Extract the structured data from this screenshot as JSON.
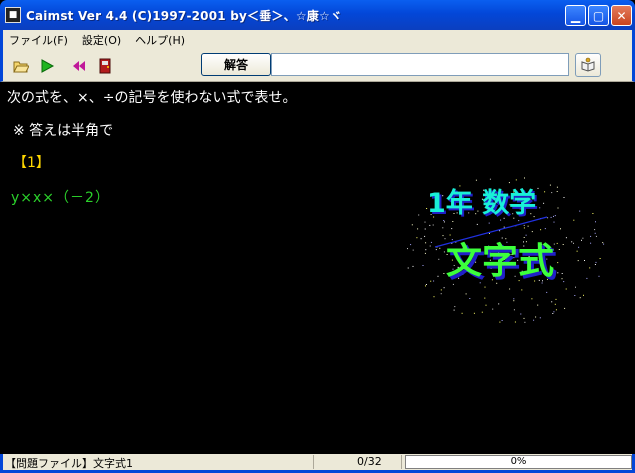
{
  "window": {
    "title": "Caimst Ver 4.4 (C)1997-2001  by＜垂＞、☆康☆ヾ",
    "icon": "app-icon"
  },
  "menu": {
    "items": [
      {
        "label": "ファイル(F)"
      },
      {
        "label": "設定(O)"
      },
      {
        "label": "ヘルプ(H)"
      }
    ]
  },
  "toolbar": {
    "icons": [
      "open-folder-icon",
      "play-icon",
      "rewind-icon",
      "exit-door-icon"
    ],
    "answer_label": "解答",
    "answer_value": "",
    "help_icon": "help-book-icon"
  },
  "question": {
    "instruction": "次の式を、×、÷の記号を使わない式で表せ。",
    "note": "※ 答えは半角で",
    "number": "【1】",
    "expression": "y×x×（－2）"
  },
  "logo": {
    "line1": "1年 数学",
    "line2": "文字式",
    "colors": {
      "line1": "#19f0d8",
      "line2": "#3cff3c",
      "shadow": "#2020c8",
      "line": "#2030e0"
    }
  },
  "status": {
    "file": "【問題ファイル】文字式1",
    "count": "0/32",
    "progress_percent": 0,
    "progress_label": "0%"
  }
}
